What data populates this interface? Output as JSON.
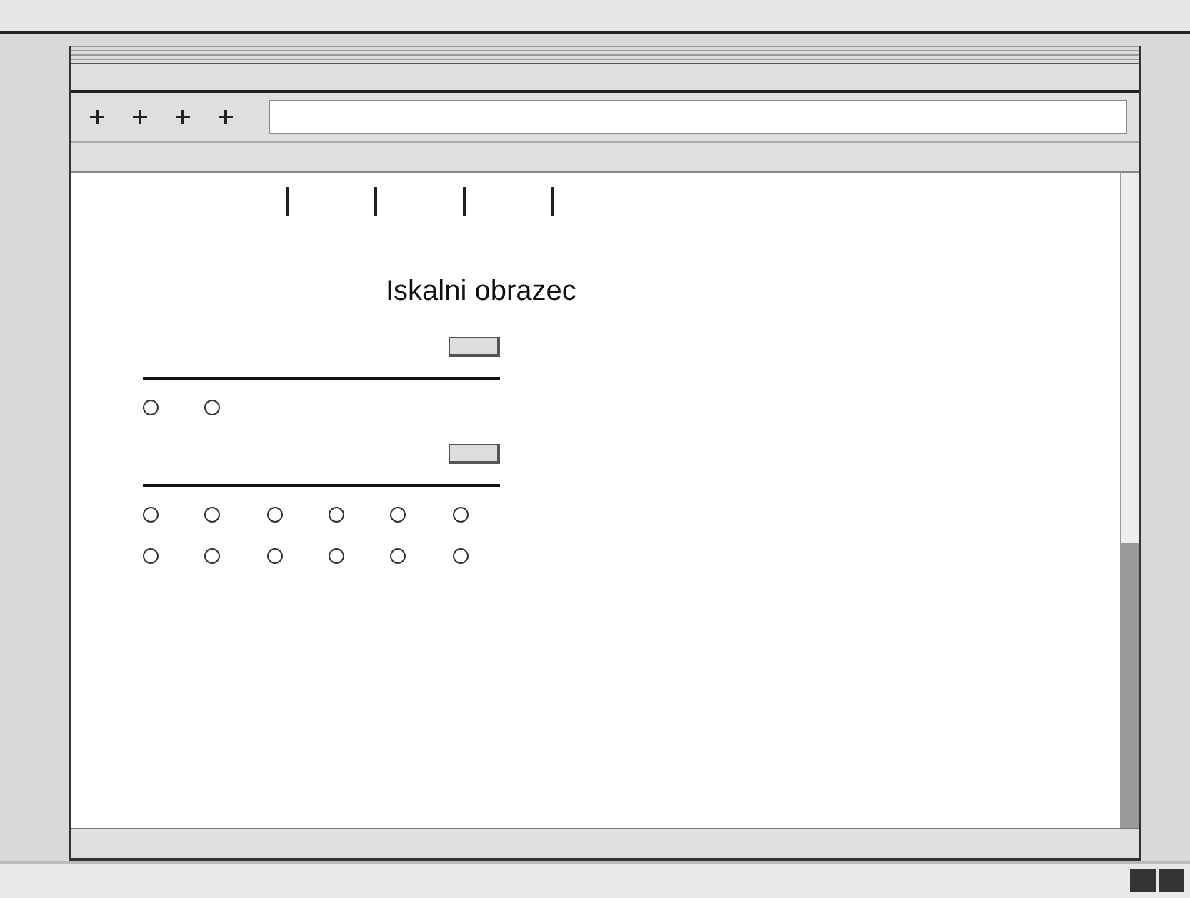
{
  "content": {
    "heading": "Iskalni obrazec"
  },
  "form_sections": [
    {
      "options": [
        {
          "selected": false
        },
        {
          "selected": false
        }
      ]
    },
    {
      "options": [
        {
          "selected": false
        },
        {
          "selected": false
        },
        {
          "selected": false
        },
        {
          "selected": false
        },
        {
          "selected": false
        },
        {
          "selected": false
        },
        {
          "selected": false
        },
        {
          "selected": false
        },
        {
          "selected": false
        },
        {
          "selected": false
        },
        {
          "selected": false
        },
        {
          "selected": false
        }
      ]
    }
  ]
}
